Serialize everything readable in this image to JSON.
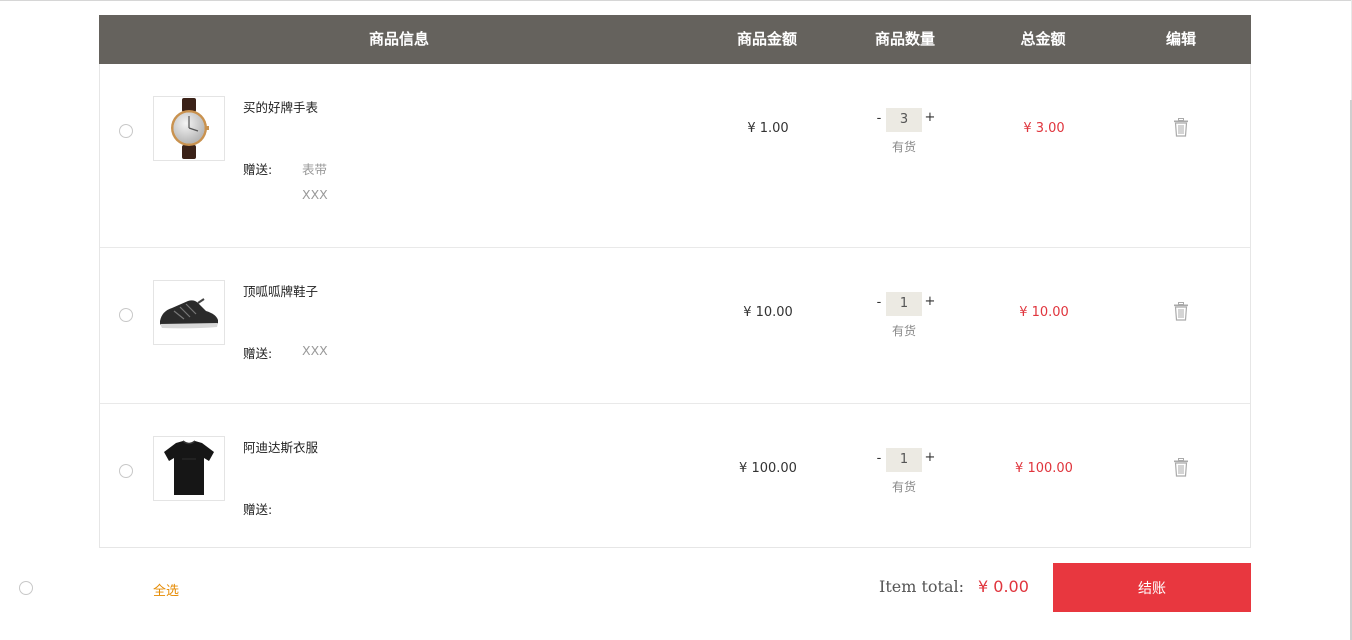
{
  "header": {
    "info": "商品信息",
    "price": "商品金额",
    "quantity": "商品数量",
    "total": "总金额",
    "edit": "编辑"
  },
  "items": [
    {
      "name": "买的好牌手表",
      "gift_label": "赠送:",
      "gifts": [
        "表带",
        "XXX"
      ],
      "price": "¥ 1.00",
      "quantity": "3",
      "minus": "-",
      "plus": "+",
      "stock": "有货",
      "total": "¥ 3.00",
      "image": "watch"
    },
    {
      "name": "顶呱呱牌鞋子",
      "gift_label": "赠送:",
      "gifts": [
        "XXX"
      ],
      "price": "¥ 10.00",
      "quantity": "1",
      "minus": "-",
      "plus": "+",
      "stock": "有货",
      "total": "¥ 10.00",
      "image": "shoe"
    },
    {
      "name": "阿迪达斯衣服",
      "gift_label": "赠送:",
      "gifts": [],
      "price": "¥ 100.00",
      "quantity": "1",
      "minus": "-",
      "plus": "+",
      "stock": "有货",
      "total": "¥ 100.00",
      "image": "tshirt"
    }
  ],
  "footer": {
    "select_all": "全选",
    "item_total_label": "Item total:",
    "item_total_value": "¥ 0.00",
    "checkout": "结账"
  },
  "colors": {
    "header_bg": "#65625d",
    "accent_red": "#e8373f",
    "select_all_orange": "#e58a00"
  },
  "icons": [
    "radio-circle",
    "trash-icon",
    "watch-image",
    "shoe-image",
    "tshirt-image"
  ]
}
